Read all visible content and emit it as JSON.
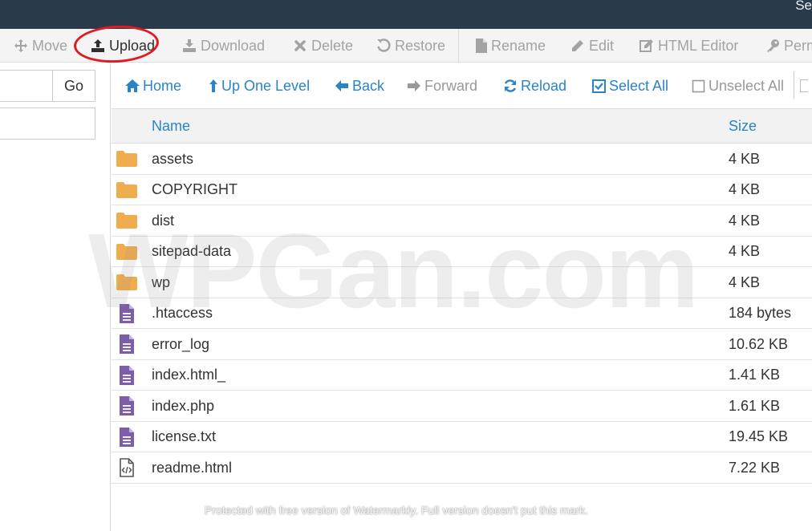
{
  "header": {
    "corner_text": "Se"
  },
  "toolbar": {
    "items": [
      {
        "label": "Move",
        "icon": "move-icon"
      },
      {
        "label": "Upload",
        "icon": "upload-icon"
      },
      {
        "label": "Download",
        "icon": "download-icon"
      },
      {
        "label": "Delete",
        "icon": "delete-icon"
      },
      {
        "label": "Restore",
        "icon": "restore-icon"
      },
      {
        "label": "Rename",
        "icon": "file-icon"
      },
      {
        "label": "Edit",
        "icon": "pencil-icon"
      },
      {
        "label": "HTML Editor",
        "icon": "edit-square-icon"
      },
      {
        "label": "Perm",
        "icon": "key-icon"
      }
    ]
  },
  "sidebar": {
    "go_label": "Go"
  },
  "nav": {
    "home": "Home",
    "up": "Up One Level",
    "back": "Back",
    "forward": "Forward",
    "reload": "Reload",
    "select_all": "Select All",
    "unselect_all": "Unselect All"
  },
  "table": {
    "headers": {
      "name": "Name",
      "size": "Size"
    },
    "rows": [
      {
        "name": "assets",
        "size": "4 KB",
        "type": "folder"
      },
      {
        "name": "COPYRIGHT",
        "size": "4 KB",
        "type": "folder"
      },
      {
        "name": "dist",
        "size": "4 KB",
        "type": "folder"
      },
      {
        "name": "sitepad-data",
        "size": "4 KB",
        "type": "folder"
      },
      {
        "name": "wp",
        "size": "4 KB",
        "type": "folder"
      },
      {
        "name": ".htaccess",
        "size": "184 bytes",
        "type": "text"
      },
      {
        "name": "error_log",
        "size": "10.62 KB",
        "type": "text"
      },
      {
        "name": "index.html_",
        "size": "1.41 KB",
        "type": "text"
      },
      {
        "name": "index.php",
        "size": "1.61 KB",
        "type": "text"
      },
      {
        "name": "license.txt",
        "size": "19.45 KB",
        "type": "text"
      },
      {
        "name": "readme.html",
        "size": "7.22 KB",
        "type": "code"
      }
    ]
  },
  "watermark": "WPGan.com",
  "footer_note": "Protected with free version of Watermarkly. Full version doesn't put this mark.",
  "colors": {
    "topbar": "#293a4a",
    "link": "#2a84c6",
    "folder": "#f0ad4e",
    "text_file": "#7b5ea7",
    "highlight": "#e01b24"
  }
}
